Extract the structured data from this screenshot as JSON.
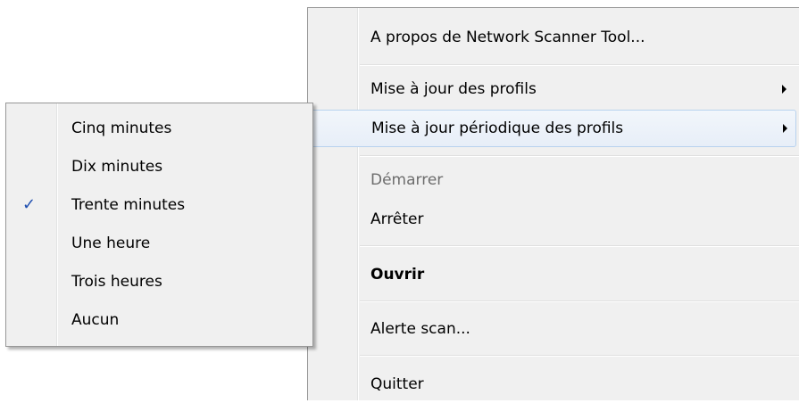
{
  "main_menu": {
    "items": [
      {
        "label": "A propos de Network Scanner Tool...",
        "has_submenu": false,
        "state": "normal"
      },
      {
        "label": "Mise à jour des profils",
        "has_submenu": true,
        "state": "normal"
      },
      {
        "label": "Mise à jour périodique des profils",
        "has_submenu": true,
        "state": "highlighted"
      },
      {
        "label": "Démarrer",
        "has_submenu": false,
        "state": "disabled"
      },
      {
        "label": "Arrêter",
        "has_submenu": false,
        "state": "normal"
      },
      {
        "label": "Ouvrir",
        "has_submenu": false,
        "state": "default"
      },
      {
        "label": "Alerte scan...",
        "has_submenu": false,
        "state": "normal"
      },
      {
        "label": "Quitter",
        "has_submenu": false,
        "state": "normal"
      }
    ]
  },
  "submenu": {
    "items": [
      {
        "label": "Cinq minutes",
        "checked": false
      },
      {
        "label": "Dix minutes",
        "checked": false
      },
      {
        "label": "Trente minutes",
        "checked": true
      },
      {
        "label": "Une heure",
        "checked": false
      },
      {
        "label": "Trois heures",
        "checked": false
      },
      {
        "label": "Aucun",
        "checked": false
      }
    ],
    "check_glyph": "✓"
  },
  "colors": {
    "menu_background": "#f0f0f0",
    "highlight_border": "#b8d2ee",
    "check_color": "#1f4fb0",
    "disabled_text": "#6d6d6d"
  }
}
